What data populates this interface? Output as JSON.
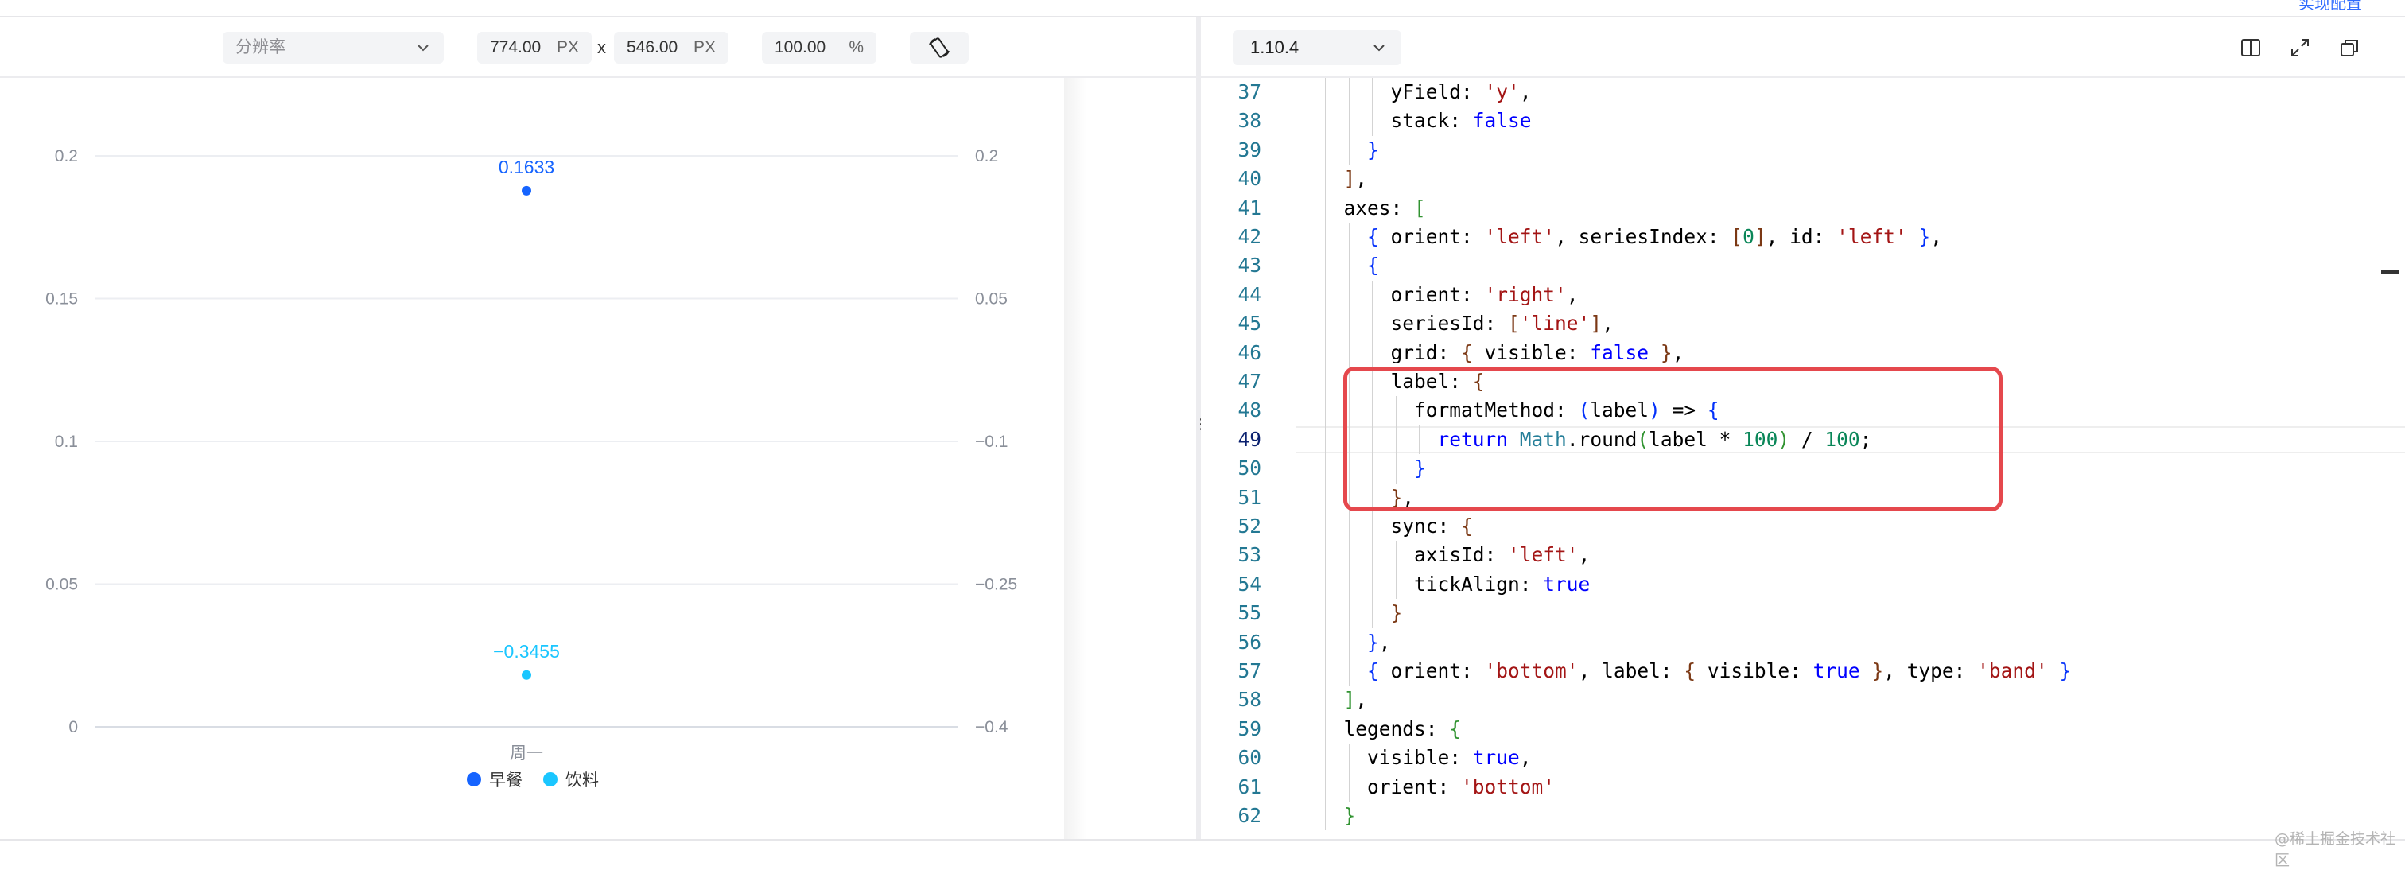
{
  "preview_toolbar": {
    "resolution_placeholder": "分辨率",
    "width_value": "774.00",
    "width_unit": "PX",
    "times_sign": "x",
    "height_value": "546.00",
    "height_unit": "PX",
    "zoom_value": "100.00",
    "zoom_unit": "%",
    "rotate_icon": "rotate-device-icon"
  },
  "editor_toolbar": {
    "version": "1.10.4",
    "icons": [
      "panel-layout-icon",
      "expand-icon",
      "copy-icon"
    ],
    "top_right_link": "实现配置"
  },
  "chart_data": {
    "type": "scatter",
    "categories": [
      "周一"
    ],
    "left_axis": {
      "ticks": [
        "0",
        "0.05",
        "0.1",
        "0.15",
        "0.2"
      ],
      "range": [
        0,
        0.2
      ]
    },
    "right_axis": {
      "ticks": [
        "−0.4",
        "−0.25",
        "−0.1",
        "0.05",
        "0.2"
      ],
      "range": [
        -0.4,
        0.2
      ]
    },
    "series": [
      {
        "name": "早餐",
        "values": [
          0.1633
        ],
        "label": "0.1633",
        "color": "#1664ff",
        "axis": "right"
      },
      {
        "name": "饮料",
        "values": [
          -0.3455
        ],
        "label": "−0.3455",
        "color": "#1ac6ff",
        "axis": "right"
      }
    ],
    "grid": true,
    "legend": "bottom"
  },
  "code": {
    "start_line": 37,
    "active_line": 49,
    "lines": [
      [
        [
          "p",
          "      yField: "
        ],
        [
          "s",
          "'y'"
        ],
        [
          "p",
          ","
        ]
      ],
      [
        [
          "p",
          "      stack: "
        ],
        [
          "k",
          "false"
        ]
      ],
      [
        [
          "p",
          "    "
        ],
        [
          "b3",
          "}"
        ]
      ],
      [
        [
          "p",
          "  "
        ],
        [
          "b2",
          "]"
        ],
        [
          "p",
          ","
        ]
      ],
      [
        [
          "p",
          "  axes: "
        ],
        [
          "b1",
          "["
        ]
      ],
      [
        [
          "p",
          "    "
        ],
        [
          "b3",
          "{"
        ],
        [
          "p",
          " orient: "
        ],
        [
          "s",
          "'left'"
        ],
        [
          "p",
          ", seriesIndex: "
        ],
        [
          "b2",
          "["
        ],
        [
          "n",
          "0"
        ],
        [
          "b2",
          "]"
        ],
        [
          "p",
          ", id: "
        ],
        [
          "s",
          "'left'"
        ],
        [
          "p",
          " "
        ],
        [
          "b3",
          "}"
        ],
        [
          "p",
          ","
        ]
      ],
      [
        [
          "p",
          "    "
        ],
        [
          "b3",
          "{"
        ]
      ],
      [
        [
          "p",
          "      orient: "
        ],
        [
          "s",
          "'right'"
        ],
        [
          "p",
          ","
        ]
      ],
      [
        [
          "p",
          "      seriesId: "
        ],
        [
          "b2",
          "["
        ],
        [
          "s",
          "'line'"
        ],
        [
          "b2",
          "]"
        ],
        [
          "p",
          ","
        ]
      ],
      [
        [
          "p",
          "      grid: "
        ],
        [
          "b2",
          "{"
        ],
        [
          "p",
          " visible: "
        ],
        [
          "k",
          "false"
        ],
        [
          "p",
          " "
        ],
        [
          "b2",
          "}"
        ],
        [
          "p",
          ","
        ]
      ],
      [
        [
          "p",
          "      label: "
        ],
        [
          "b2",
          "{"
        ]
      ],
      [
        [
          "p",
          "        formatMethod: "
        ],
        [
          "b3",
          "("
        ],
        [
          "p",
          "label"
        ],
        [
          "b3",
          ")"
        ],
        [
          "p",
          " => "
        ],
        [
          "b3",
          "{"
        ]
      ],
      [
        [
          "p",
          "          "
        ],
        [
          "k",
          "return"
        ],
        [
          "p",
          " "
        ],
        [
          "c",
          "Math"
        ],
        [
          "p",
          ".round"
        ],
        [
          "b1",
          "("
        ],
        [
          "p",
          "label * "
        ],
        [
          "n",
          "100"
        ],
        [
          "b1",
          ")"
        ],
        [
          "p",
          " / "
        ],
        [
          "n",
          "100"
        ],
        [
          "p",
          ";"
        ]
      ],
      [
        [
          "p",
          "        "
        ],
        [
          "b3",
          "}"
        ]
      ],
      [
        [
          "p",
          "      "
        ],
        [
          "b2",
          "}"
        ],
        [
          "p",
          ","
        ]
      ],
      [
        [
          "p",
          "      sync: "
        ],
        [
          "b2",
          "{"
        ]
      ],
      [
        [
          "p",
          "        axisId: "
        ],
        [
          "s",
          "'left'"
        ],
        [
          "p",
          ","
        ]
      ],
      [
        [
          "p",
          "        tickAlign: "
        ],
        [
          "k",
          "true"
        ]
      ],
      [
        [
          "p",
          "      "
        ],
        [
          "b2",
          "}"
        ]
      ],
      [
        [
          "p",
          "    "
        ],
        [
          "b3",
          "}"
        ],
        [
          "p",
          ","
        ]
      ],
      [
        [
          "p",
          "    "
        ],
        [
          "b3",
          "{"
        ],
        [
          "p",
          " orient: "
        ],
        [
          "s",
          "'bottom'"
        ],
        [
          "p",
          ", label: "
        ],
        [
          "b2",
          "{"
        ],
        [
          "p",
          " visible: "
        ],
        [
          "k",
          "true"
        ],
        [
          "p",
          " "
        ],
        [
          "b2",
          "}"
        ],
        [
          "p",
          ", type: "
        ],
        [
          "s",
          "'band'"
        ],
        [
          "p",
          " "
        ],
        [
          "b3",
          "}"
        ]
      ],
      [
        [
          "p",
          "  "
        ],
        [
          "b1",
          "]"
        ],
        [
          "p",
          ","
        ]
      ],
      [
        [
          "p",
          "  legends: "
        ],
        [
          "b1",
          "{"
        ]
      ],
      [
        [
          "p",
          "    visible: "
        ],
        [
          "k",
          "true"
        ],
        [
          "p",
          ","
        ]
      ],
      [
        [
          "p",
          "    orient: "
        ],
        [
          "s",
          "'bottom'"
        ]
      ],
      [
        [
          "p",
          "  "
        ],
        [
          "b1",
          "}"
        ]
      ]
    ]
  },
  "watermark": "@稀土掘金技术社区",
  "splitter_glyph": "⋮"
}
